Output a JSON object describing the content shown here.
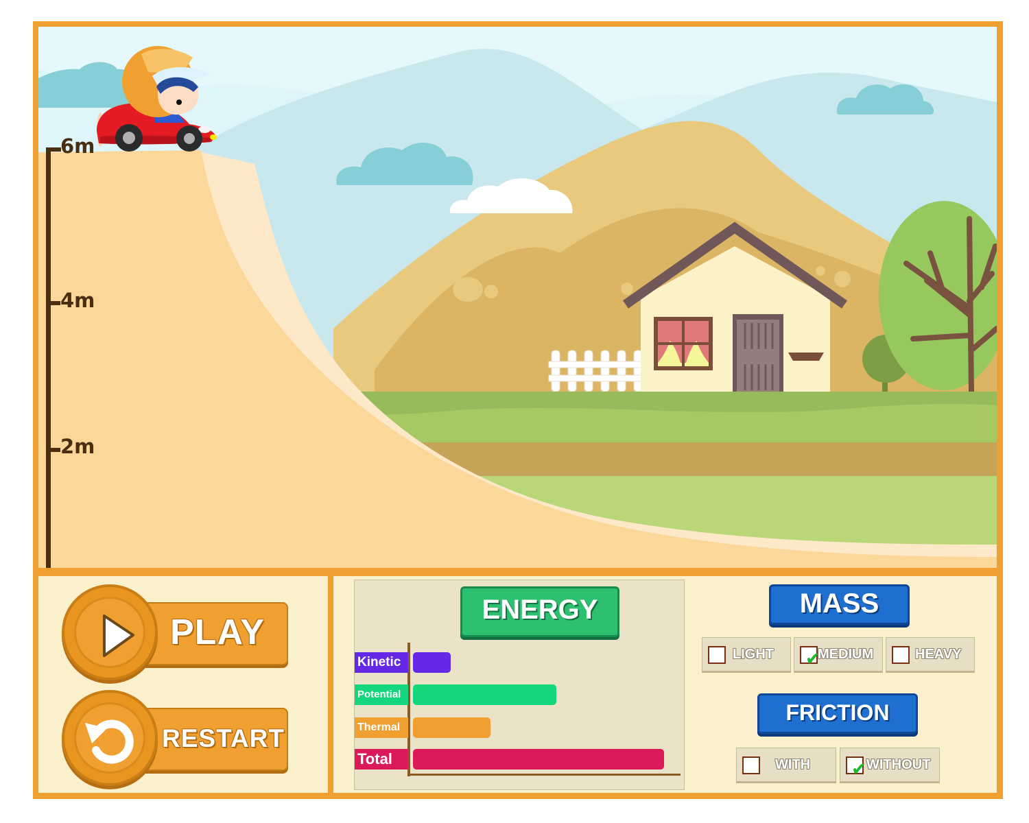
{
  "scale": {
    "marks": [
      "6m",
      "4m",
      "2m"
    ]
  },
  "controls": {
    "play_label": "PLAY",
    "restart_label": "RESTART"
  },
  "energy": {
    "title": "ENERGY",
    "bars": [
      {
        "label": "Kinetic",
        "value": 0.15,
        "color": "#6529e6"
      },
      {
        "label": "Potential",
        "value": 0.57,
        "color": "#14d67c"
      },
      {
        "label": "Thermal",
        "value": 0.31,
        "color": "#f0a030"
      },
      {
        "label": "Total",
        "value": 1.0,
        "color": "#dc1a5a"
      }
    ]
  },
  "mass": {
    "title": "MASS",
    "options": [
      {
        "label": "LIGHT",
        "checked": false
      },
      {
        "label": "MEDIUM",
        "checked": true
      },
      {
        "label": "HEAVY",
        "checked": false
      }
    ]
  },
  "friction": {
    "title": "FRICTION",
    "options": [
      {
        "label": "WITH",
        "checked": false
      },
      {
        "label": "WITHOUT",
        "checked": true
      }
    ]
  },
  "icons": {
    "play": "play-triangle-icon",
    "restart": "restart-arrow-icon",
    "check": "checkmark-icon"
  },
  "colors": {
    "frame": "#f0a030",
    "ramp": "#fcd79a",
    "mass_button": "#1f6fd0",
    "energy_button": "#2cc070"
  }
}
